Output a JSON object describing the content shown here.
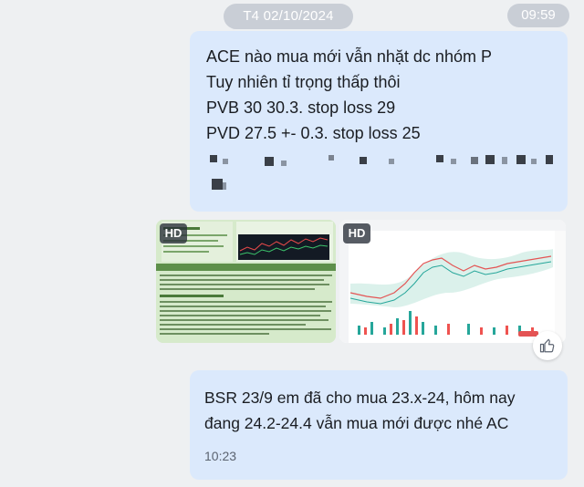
{
  "date_separator": "T4 02/10/2024",
  "top_time": "09:59",
  "message_1": {
    "lines": [
      "ACE nào mua mới vẫn nhặt dc nhóm P",
      "Tuy nhiên tỉ trọng thấp thôi",
      "PVB 30 30.3. stop loss 29",
      "PVD 27.5 +- 0.3. stop loss 25"
    ]
  },
  "attachments": {
    "image_1": {
      "badge": "HD"
    },
    "image_2": {
      "badge": "HD"
    }
  },
  "message_2": {
    "lines": [
      "BSR 23/9 em đã cho mua 23.x-24, hôm nay",
      "đang 24.2-24.4 vẫn mua mới được nhé AC"
    ],
    "time": "10:23"
  },
  "icons": {
    "like": "thumbs-up-icon"
  },
  "colors": {
    "background": "#eef0f2",
    "bubble": "#dbe9fc",
    "pill": "#c9ced6",
    "text": "#1a1d22"
  }
}
